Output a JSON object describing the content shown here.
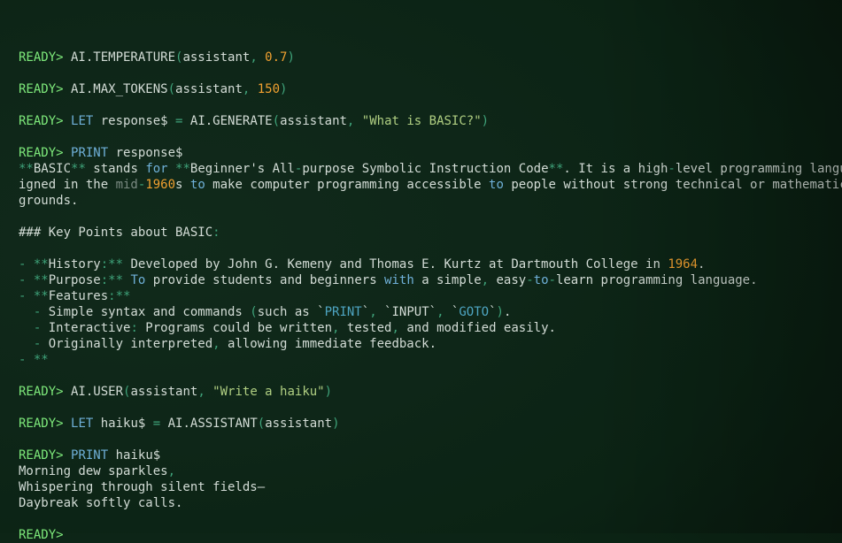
{
  "prompt": "READY>",
  "lines": [
    [],
    [
      {
        "t": "READY>",
        "c": "p"
      },
      {
        "t": " AI.TEMPERATURE",
        "c": "t"
      },
      {
        "t": "(",
        "c": "pu"
      },
      {
        "t": "assistant",
        "c": "t"
      },
      {
        "t": ", ",
        "c": "pu"
      },
      {
        "t": "0.7",
        "c": "n"
      },
      {
        "t": ")",
        "c": "pu"
      }
    ],
    [],
    [
      {
        "t": "READY>",
        "c": "p"
      },
      {
        "t": " AI.MAX_TOKENS",
        "c": "t"
      },
      {
        "t": "(",
        "c": "pu"
      },
      {
        "t": "assistant",
        "c": "t"
      },
      {
        "t": ", ",
        "c": "pu"
      },
      {
        "t": "150",
        "c": "n"
      },
      {
        "t": ")",
        "c": "pu"
      }
    ],
    [],
    [
      {
        "t": "READY>",
        "c": "p"
      },
      {
        "t": " ",
        "c": "t"
      },
      {
        "t": "LET",
        "c": "kw"
      },
      {
        "t": " response$ ",
        "c": "t"
      },
      {
        "t": "=",
        "c": "pu"
      },
      {
        "t": " AI.GENERATE",
        "c": "t"
      },
      {
        "t": "(",
        "c": "pu"
      },
      {
        "t": "assistant",
        "c": "t"
      },
      {
        "t": ", ",
        "c": "pu"
      },
      {
        "t": "\"What is BASIC?\"",
        "c": "s"
      },
      {
        "t": ")",
        "c": "pu"
      }
    ],
    [],
    [
      {
        "t": "READY>",
        "c": "p"
      },
      {
        "t": " ",
        "c": "t"
      },
      {
        "t": "PRINT",
        "c": "kw"
      },
      {
        "t": " response$",
        "c": "t"
      }
    ],
    [
      {
        "t": "**",
        "c": "pu"
      },
      {
        "t": "BASIC",
        "c": "t"
      },
      {
        "t": "**",
        "c": "pu"
      },
      {
        "t": " stands ",
        "c": "t"
      },
      {
        "t": "for",
        "c": "kw"
      },
      {
        "t": " ",
        "c": "t"
      },
      {
        "t": "**",
        "c": "pu"
      },
      {
        "t": "Beginner's All",
        "c": "t"
      },
      {
        "t": "-",
        "c": "pu"
      },
      {
        "t": "purpose Symbolic Instruction Code",
        "c": "t"
      },
      {
        "t": "**",
        "c": "pu"
      },
      {
        "t": ". It is a high",
        "c": "t"
      },
      {
        "t": "-",
        "c": "pu"
      },
      {
        "t": "level programming language des",
        "c": "t"
      }
    ],
    [
      {
        "t": "igned in the ",
        "c": "t"
      },
      {
        "t": "mid",
        "c": "d"
      },
      {
        "t": "-",
        "c": "pu"
      },
      {
        "t": "1960",
        "c": "n"
      },
      {
        "t": "s ",
        "c": "t"
      },
      {
        "t": "to",
        "c": "kw"
      },
      {
        "t": " make computer programming accessible ",
        "c": "t"
      },
      {
        "t": "to",
        "c": "kw"
      },
      {
        "t": " people without strong technical or mathematical back",
        "c": "t"
      }
    ],
    [
      {
        "t": "grounds.",
        "c": "t"
      }
    ],
    [],
    [
      {
        "t": "### Key Points about BASIC",
        "c": "t"
      },
      {
        "t": ":",
        "c": "pu"
      }
    ],
    [],
    [
      {
        "t": "- ",
        "c": "pu"
      },
      {
        "t": "**",
        "c": "pu"
      },
      {
        "t": "History",
        "c": "t"
      },
      {
        "t": ":**",
        "c": "pu"
      },
      {
        "t": " Developed by John G. Kemeny and Thomas E. Kurtz at Dartmouth College in ",
        "c": "t"
      },
      {
        "t": "1964",
        "c": "n"
      },
      {
        "t": ".",
        "c": "t"
      }
    ],
    [
      {
        "t": "- ",
        "c": "pu"
      },
      {
        "t": "**",
        "c": "pu"
      },
      {
        "t": "Purpose",
        "c": "t"
      },
      {
        "t": ":**",
        "c": "pu"
      },
      {
        "t": " ",
        "c": "t"
      },
      {
        "t": "To",
        "c": "kw"
      },
      {
        "t": " provide students and beginners ",
        "c": "t"
      },
      {
        "t": "with",
        "c": "kw"
      },
      {
        "t": " a simple",
        "c": "t"
      },
      {
        "t": ",",
        "c": "pu"
      },
      {
        "t": " easy",
        "c": "t"
      },
      {
        "t": "-",
        "c": "pu"
      },
      {
        "t": "to",
        "c": "kw"
      },
      {
        "t": "-",
        "c": "pu"
      },
      {
        "t": "learn programming language.",
        "c": "t"
      }
    ],
    [
      {
        "t": "- ",
        "c": "pu"
      },
      {
        "t": "**",
        "c": "pu"
      },
      {
        "t": "Features",
        "c": "t"
      },
      {
        "t": ":**",
        "c": "pu"
      }
    ],
    [
      {
        "t": "  ",
        "c": "t"
      },
      {
        "t": "- ",
        "c": "pu"
      },
      {
        "t": "Simple syntax and commands ",
        "c": "t"
      },
      {
        "t": "(",
        "c": "pu"
      },
      {
        "t": "such as `",
        "c": "t"
      },
      {
        "t": "PRINT",
        "c": "bt"
      },
      {
        "t": "`",
        "c": "t"
      },
      {
        "t": ", ",
        "c": "pu"
      },
      {
        "t": "`INPUT`",
        "c": "t"
      },
      {
        "t": ", ",
        "c": "pu"
      },
      {
        "t": "`",
        "c": "t"
      },
      {
        "t": "GOTO",
        "c": "bt"
      },
      {
        "t": "`",
        "c": "t"
      },
      {
        "t": ")",
        "c": "pu"
      },
      {
        "t": ".",
        "c": "t"
      }
    ],
    [
      {
        "t": "  ",
        "c": "t"
      },
      {
        "t": "- ",
        "c": "pu"
      },
      {
        "t": "Interactive",
        "c": "t"
      },
      {
        "t": ":",
        "c": "pu"
      },
      {
        "t": " Programs could be written",
        "c": "t"
      },
      {
        "t": ",",
        "c": "pu"
      },
      {
        "t": " tested",
        "c": "t"
      },
      {
        "t": ",",
        "c": "pu"
      },
      {
        "t": " and modified easily.",
        "c": "t"
      }
    ],
    [
      {
        "t": "  ",
        "c": "t"
      },
      {
        "t": "- ",
        "c": "pu"
      },
      {
        "t": "Originally interpreted",
        "c": "t"
      },
      {
        "t": ",",
        "c": "pu"
      },
      {
        "t": " allowing immediate feedback.",
        "c": "t"
      }
    ],
    [
      {
        "t": "- **",
        "c": "pu"
      }
    ],
    [],
    [
      {
        "t": "READY>",
        "c": "p"
      },
      {
        "t": " AI.USER",
        "c": "t"
      },
      {
        "t": "(",
        "c": "pu"
      },
      {
        "t": "assistant",
        "c": "t"
      },
      {
        "t": ", ",
        "c": "pu"
      },
      {
        "t": "\"Write a haiku\"",
        "c": "s"
      },
      {
        "t": ")",
        "c": "pu"
      }
    ],
    [],
    [
      {
        "t": "READY>",
        "c": "p"
      },
      {
        "t": " ",
        "c": "t"
      },
      {
        "t": "LET",
        "c": "kw"
      },
      {
        "t": " haiku$ ",
        "c": "t"
      },
      {
        "t": "=",
        "c": "pu"
      },
      {
        "t": " AI.ASSISTANT",
        "c": "t"
      },
      {
        "t": "(",
        "c": "pu"
      },
      {
        "t": "assistant",
        "c": "t"
      },
      {
        "t": ")",
        "c": "pu"
      }
    ],
    [],
    [
      {
        "t": "READY>",
        "c": "p"
      },
      {
        "t": " ",
        "c": "t"
      },
      {
        "t": "PRINT",
        "c": "kw"
      },
      {
        "t": " haiku$",
        "c": "t"
      }
    ],
    [
      {
        "t": "Morning dew sparkles",
        "c": "t"
      },
      {
        "t": ",",
        "c": "pu"
      }
    ],
    [
      {
        "t": "Whispering through silent fields—",
        "c": "t"
      }
    ],
    [
      {
        "t": "Daybreak softly calls.",
        "c": "t"
      }
    ],
    [],
    [
      {
        "t": "READY>",
        "c": "p"
      }
    ]
  ]
}
